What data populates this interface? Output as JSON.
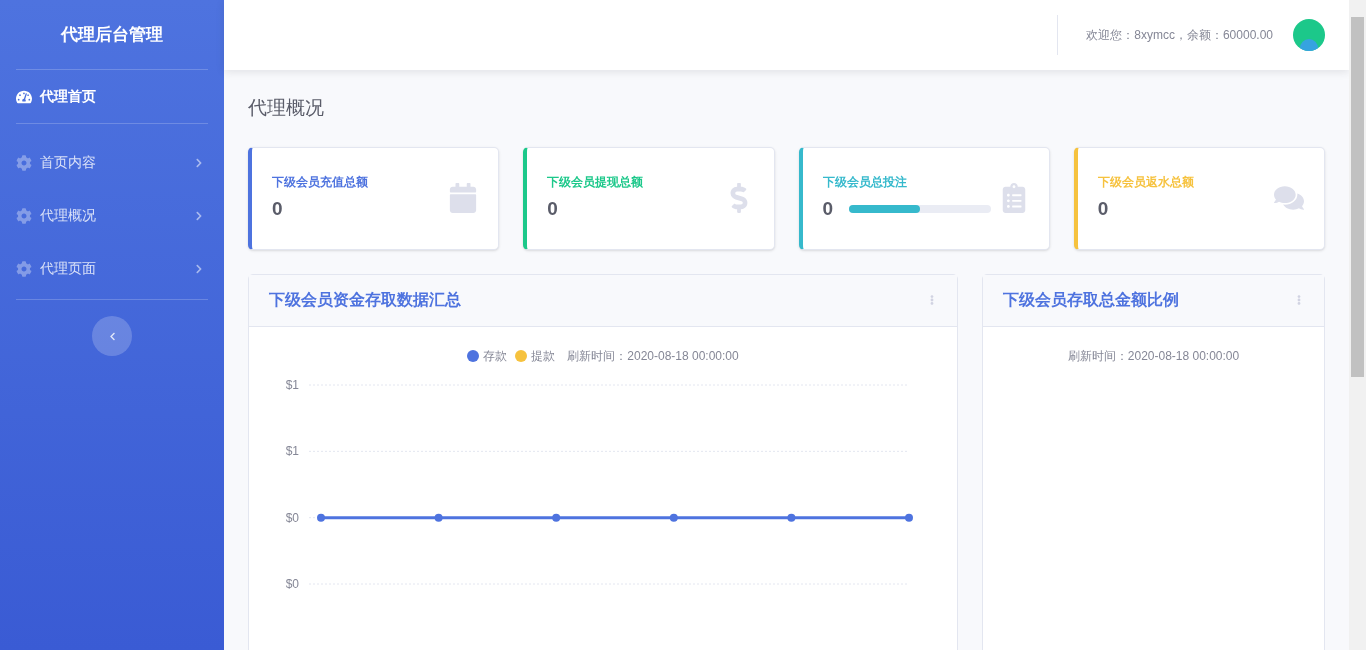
{
  "sidebar": {
    "title": "代理后台管理",
    "items": [
      {
        "label": "代理首页",
        "selected": true,
        "kind": "home"
      },
      {
        "label": "首页内容",
        "selected": false,
        "kind": "menu"
      },
      {
        "label": "代理概况",
        "selected": false,
        "kind": "menu"
      },
      {
        "label": "代理页面",
        "selected": false,
        "kind": "menu"
      }
    ]
  },
  "header": {
    "welcome": "欢迎您：8xymcc，余额：60000.00"
  },
  "page_title": "代理概况",
  "stats": [
    {
      "label": "下级会员充值总额",
      "value": "0",
      "color": "#4e73df",
      "kind": "calendar"
    },
    {
      "label": "下级会员提现总额",
      "value": "0",
      "color": "#1cc88a",
      "kind": "dollar"
    },
    {
      "label": "下级会员总投注",
      "value": "0",
      "color": "#36b9cc",
      "kind": "clipboard",
      "level": 0.5
    },
    {
      "label": "下级会员返水总额",
      "value": "0",
      "color": "#f6c23e",
      "kind": "comments"
    }
  ],
  "line_panel": {
    "title": "下级会员资金存取数据汇总",
    "refresh": "刷新时间：2020-08-18 00:00:00",
    "chart_data": {
      "type": "line",
      "ylim": [
        -0.5,
        1
      ],
      "yticks": [
        {
          "value": 1,
          "label": "$1"
        },
        {
          "value": 0.5,
          "label": "$1"
        },
        {
          "value": 0,
          "label": "$0"
        },
        {
          "value": -0.5,
          "label": "$0"
        }
      ],
      "series": [
        {
          "name": "存款",
          "color": "#4e73df",
          "marker": "circle",
          "values": [
            0,
            0,
            0,
            0,
            0,
            0
          ]
        },
        {
          "name": "提款",
          "color": "#f6c23e",
          "marker": "circle",
          "values": [
            null,
            null,
            null,
            null,
            null,
            null
          ]
        }
      ]
    }
  },
  "pie_panel": {
    "title": "下级会员存取总金额比例",
    "refresh": "刷新时间：2020-08-18 00:00:00"
  }
}
